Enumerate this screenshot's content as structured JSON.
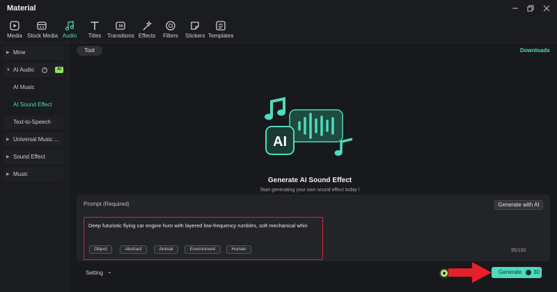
{
  "window": {
    "title": "Material"
  },
  "toolbar": {
    "items": [
      {
        "label": "Media",
        "icon": "media-icon"
      },
      {
        "label": "Stock Media",
        "icon": "stock-media-icon"
      },
      {
        "label": "Audio",
        "icon": "music-note-icon",
        "active": true
      },
      {
        "label": "Titles",
        "icon": "titles-icon"
      },
      {
        "label": "Transitions",
        "icon": "transitions-icon"
      },
      {
        "label": "Effects",
        "icon": "effects-icon"
      },
      {
        "label": "Filters",
        "icon": "filters-icon"
      },
      {
        "label": "Stickers",
        "icon": "stickers-icon"
      },
      {
        "label": "Templates",
        "icon": "templates-icon"
      }
    ]
  },
  "sidebar": {
    "items": [
      {
        "label": "Mine"
      },
      {
        "label": "AI Audio",
        "badge": "AI"
      },
      {
        "label": "AI Music"
      },
      {
        "label": "AI Sound Effect",
        "active": true
      },
      {
        "label": "Text-to-Speech"
      },
      {
        "label": "Universal Music ..."
      },
      {
        "label": "Sound Effect"
      },
      {
        "label": "Music"
      }
    ]
  },
  "main": {
    "tab_label": "Tool",
    "downloads_label": "Downloads",
    "hero_title": "Generate AI Sound Effect",
    "hero_subtitle": "Start generating your own sound effect today !",
    "illustration_text": "AI",
    "prompt": {
      "label": "Prompt (Required)",
      "generate_with_ai_label": "Generate with AI",
      "text": "Deep futuristic flying car engine hum with layered low-frequency rumbles, soft mechanical whin",
      "tags": [
        "Object",
        "Abstract",
        "Animal",
        "Environment",
        "Human"
      ],
      "counter": "95/100"
    },
    "footer": {
      "setting_label": "Setting",
      "generate_label": "Generate",
      "credits": "30"
    }
  },
  "colors": {
    "accent": "#4ddcbd",
    "highlight_border": "#d3272d",
    "arrow": "#e5202a"
  }
}
